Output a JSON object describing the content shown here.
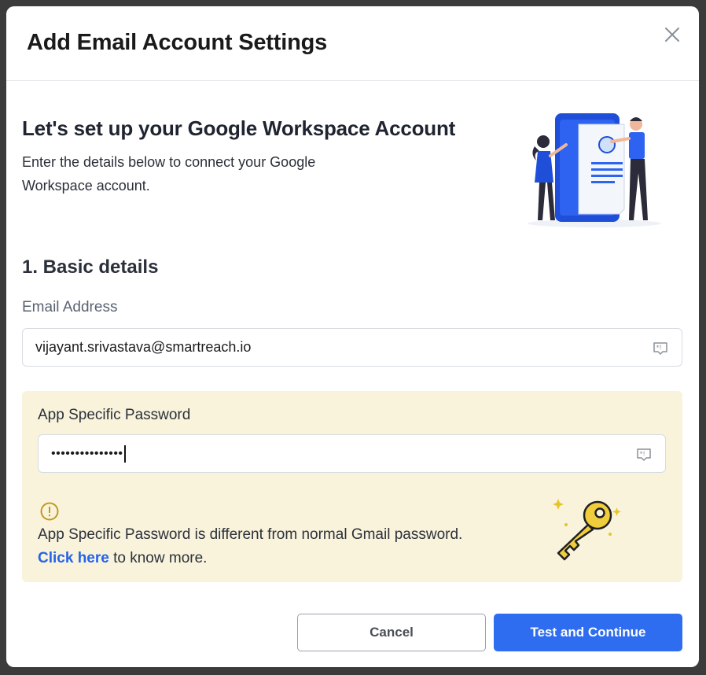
{
  "modal": {
    "title": "Add Email Account Settings"
  },
  "hero": {
    "title": "Let's set up your Google Workspace Account",
    "subtitle": "Enter the details below to connect your Google Workspace account."
  },
  "basic_details": {
    "section_title": "1. Basic details",
    "email_label": "Email Address",
    "email_value": "vijayant.srivastava@smartreach.io"
  },
  "app_password": {
    "label": "App Specific Password",
    "masked_value": "•••••••••••••••",
    "note": "App Specific Password is different from normal Gmail password.",
    "link_text": "Click here",
    "link_suffix": " to know more."
  },
  "footer": {
    "cancel_label": "Cancel",
    "submit_label": "Test and Continue"
  },
  "colors": {
    "primary": "#2f6df0",
    "warning_bg": "#f9f3dc",
    "link": "#2563eb",
    "key": "#f0cd3c"
  },
  "icons": {
    "close": "close-icon",
    "autofill": "autofill-icon",
    "info": "info-circle-icon",
    "key": "key-illustration"
  }
}
